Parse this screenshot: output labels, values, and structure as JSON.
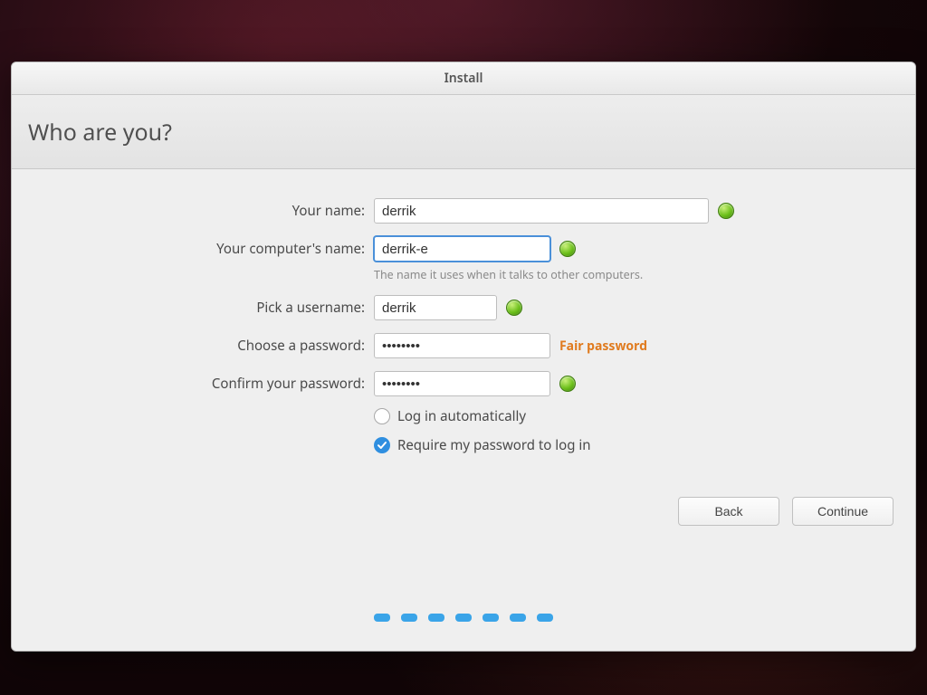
{
  "window": {
    "title": "Install"
  },
  "header": {
    "heading": "Who are you?"
  },
  "form": {
    "name": {
      "label": "Your name:",
      "value": "derrik"
    },
    "computer": {
      "label": "Your computer's name:",
      "value": "derrik-e",
      "hint": "The name it uses when it talks to other computers."
    },
    "username": {
      "label": "Pick a username:",
      "value": "derrik"
    },
    "password": {
      "label": "Choose a password:",
      "value": "••••••••",
      "strength": "Fair password"
    },
    "confirm": {
      "label": "Confirm your password:",
      "value": "••••••••"
    },
    "login_auto": {
      "label": "Log in automatically",
      "selected": false
    },
    "login_pwd": {
      "label": "Require my password to log in",
      "selected": true
    }
  },
  "buttons": {
    "back": "Back",
    "continue": "Continue"
  },
  "progress": {
    "steps": 7
  }
}
